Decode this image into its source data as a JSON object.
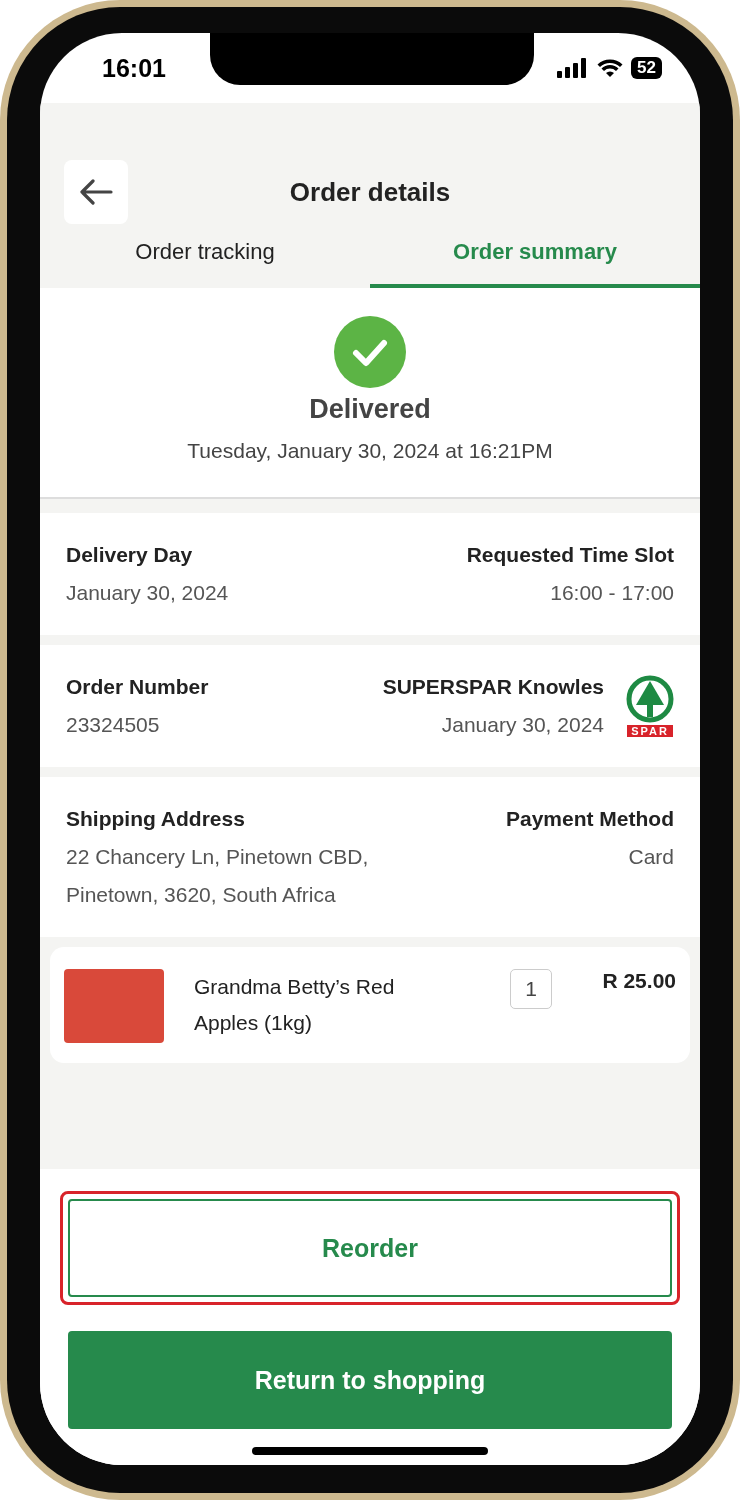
{
  "status_bar": {
    "time": "16:01",
    "battery": "52"
  },
  "header": {
    "title": "Order details"
  },
  "tabs": [
    {
      "label": "Order tracking",
      "selected": false
    },
    {
      "label": "Order summary",
      "selected": true
    }
  ],
  "status": {
    "label": "Delivered",
    "date": "Tuesday, January 30, 2024 at 16:21PM"
  },
  "details": [
    {
      "left_label": "Delivery Day",
      "left_value": [
        "January 30, 2024"
      ],
      "right_label": "Requested Time Slot",
      "right_value": [
        "16:00 - 17:00"
      ]
    },
    {
      "left_label": "Order Number",
      "left_value": [
        "23324505"
      ],
      "right_label": "SUPERSPAR Knowles",
      "right_value": [
        "January 30, 2024"
      ],
      "logo": "SPAR"
    },
    {
      "left_label": "Shipping Address",
      "left_value": [
        "22 Chancery Ln, Pinetown CBD,",
        "Pinetown, 3620, South Africa"
      ],
      "right_label": "Payment Method",
      "right_value": [
        "Card"
      ]
    }
  ],
  "items": [
    {
      "name": "Grandma Betty’s Red Apples (1kg)",
      "quantity": "1",
      "price": "R 25.00"
    }
  ],
  "buttons": [
    {
      "label": "Reorder",
      "kind": "outline",
      "highlighted": true
    },
    {
      "label": "Return to shopping",
      "kind": "filled",
      "highlighted": false
    }
  ]
}
